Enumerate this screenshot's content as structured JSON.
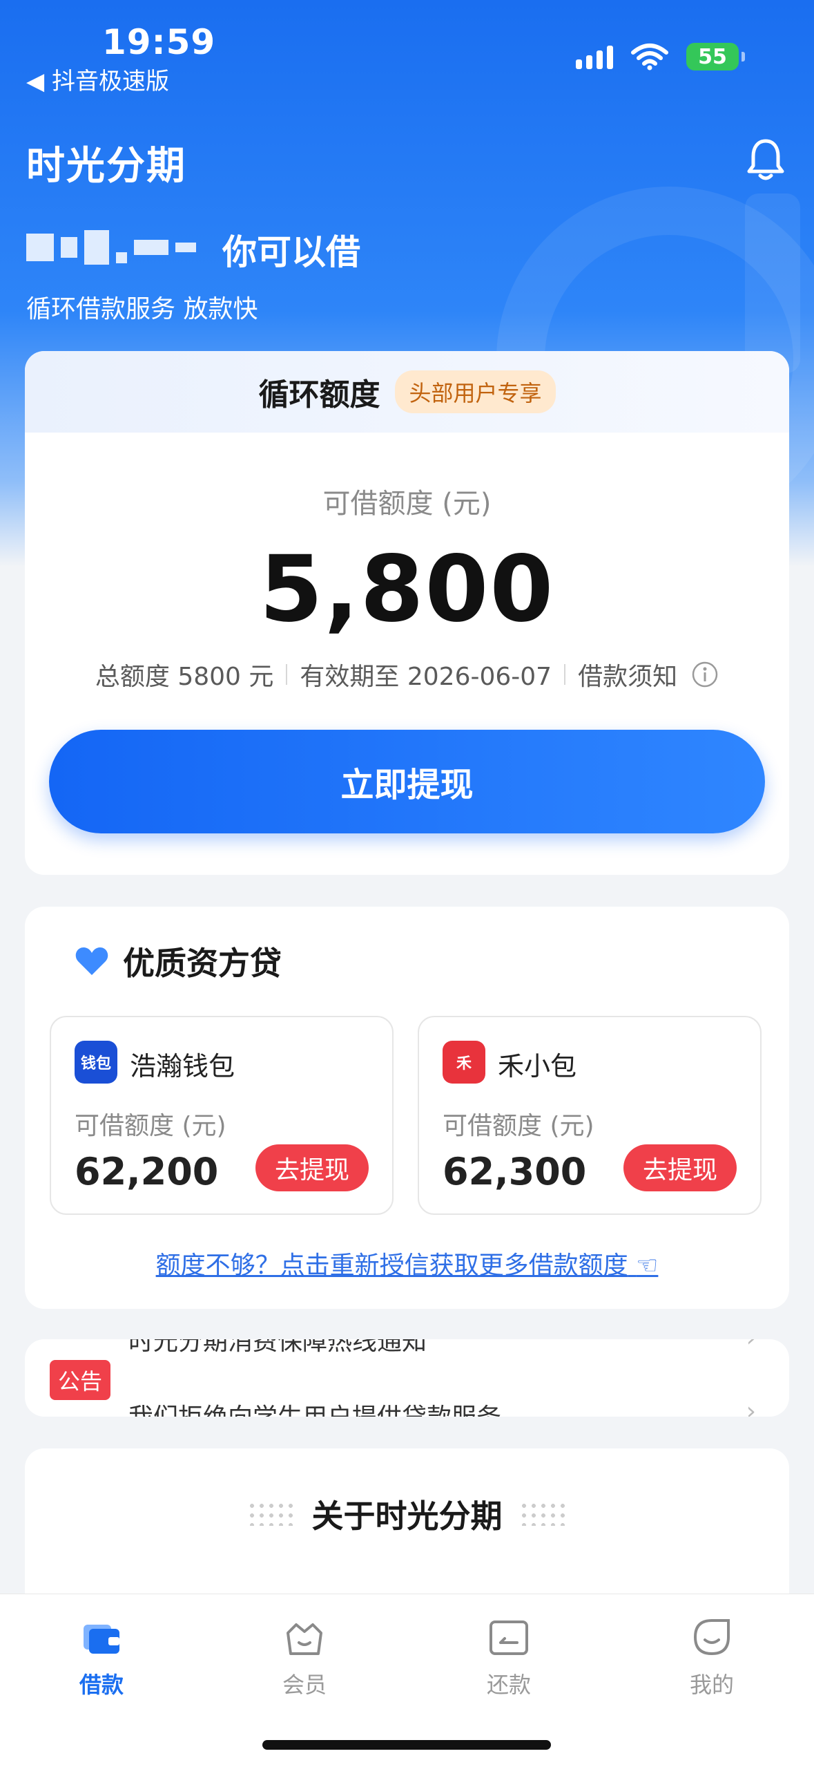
{
  "status_bar": {
    "time": "19:59",
    "back_app": "◀ 抖音极速版",
    "battery": "55"
  },
  "header": {
    "app_title": "时光分期",
    "can_borrow": "你可以借",
    "subtitle": "循环借款服务 放款快"
  },
  "credit": {
    "title": "循环额度",
    "tag": "头部用户专享",
    "available_label": "可借额度 (元)",
    "amount": "5,800",
    "total": "总额度 5800 元",
    "valid_until": "有效期至 2026-06-07",
    "notice_link": "借款须知",
    "withdraw_button": "立即提现"
  },
  "lenders": {
    "title": "优质资方贷",
    "items": [
      {
        "name": "浩瀚钱包",
        "logo_text": "钱包",
        "logo_color": "#1a4fd6",
        "available_label": "可借额度 (元)",
        "amount": "62,200",
        "button": "去提现"
      },
      {
        "name": "禾小包",
        "logo_text": "禾",
        "logo_color": "#e8333c",
        "available_label": "可借额度 (元)",
        "amount": "62,300",
        "button": "去提现"
      }
    ],
    "more_link": "额度不够？点击重新授信获取更多借款额度"
  },
  "notice": {
    "tag": "公告",
    "line1": "时光分期消费保障热线通知",
    "line2": "我们拒绝向学生用户提供贷款服务"
  },
  "about": {
    "title": "关于时光分期"
  },
  "tabs": [
    {
      "label": "借款",
      "icon": "wallet-icon",
      "active": true
    },
    {
      "label": "会员",
      "icon": "basket-icon",
      "active": false
    },
    {
      "label": "还款",
      "icon": "card-icon",
      "active": false
    },
    {
      "label": "我的",
      "icon": "smile-icon",
      "active": false
    }
  ],
  "colors": {
    "brand_blue": "#1a6ef0",
    "action_red": "#f0404a"
  }
}
